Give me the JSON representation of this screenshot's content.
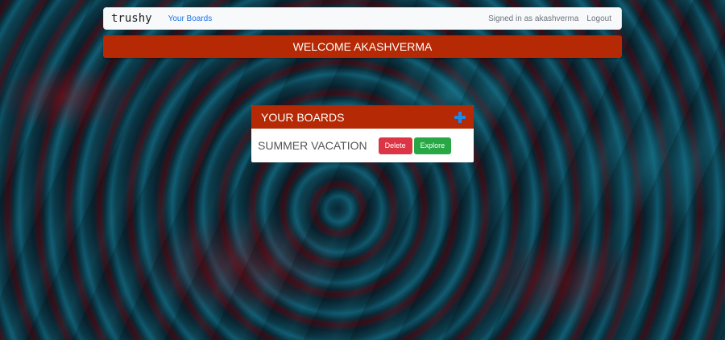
{
  "navbar": {
    "brand": "trushy",
    "boards_link": "Your Boards",
    "signed_in": "Signed in as akashverma",
    "logout": "Logout"
  },
  "welcome": "WELCOME AKASHVERMA",
  "boards": {
    "title": "YOUR BOARDS",
    "add_icon": "plus-icon",
    "items": [
      {
        "name": "SUMMER VACATION",
        "delete_label": "Delete",
        "explore_label": "Explore"
      }
    ]
  },
  "colors": {
    "primary": "#b52a05",
    "danger": "#dc3545",
    "success": "#28a745",
    "link": "#1a73e8",
    "add_icon": "#1e88e5"
  }
}
